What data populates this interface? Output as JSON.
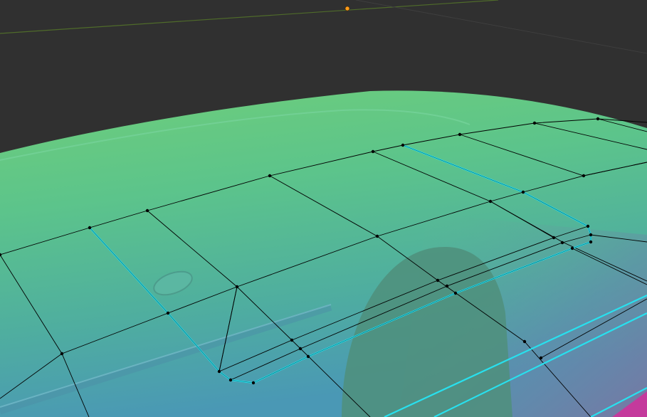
{
  "viewport": {
    "editor": "3d-viewport",
    "mode": "edit-mode",
    "shading": "solid",
    "colors": {
      "background": "#303030",
      "floor_line": "#4f6b2a",
      "grid_line": "#3e3e3e",
      "origin_point": "#ff9b1a",
      "wire_edge": "#000000",
      "vertex": "#000000",
      "selected_edge": "#28e0ee",
      "mesh_top": "#6fce7a",
      "mesh_mid": "#58bd95",
      "mesh_bottom": "#4a9ab6",
      "mesh_shadow": "#4f8f7b",
      "mesh_magenta": "#c43a9c"
    },
    "icons": {
      "object_origin": "origin-point-icon"
    }
  }
}
